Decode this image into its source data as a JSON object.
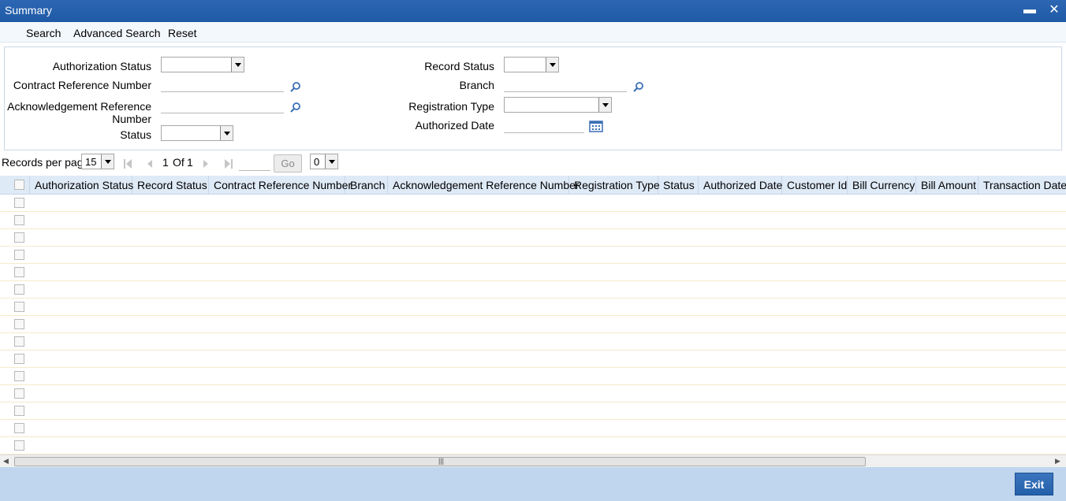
{
  "window": {
    "title": "Summary"
  },
  "toolbar": {
    "search": "Search",
    "advanced_search": "Advanced Search",
    "reset": "Reset"
  },
  "form": {
    "authorization_status": {
      "label": "Authorization Status",
      "value": ""
    },
    "contract_reference_number": {
      "label": "Contract Reference Number",
      "value": ""
    },
    "acknowledgement_reference_number": {
      "label_line1": "Acknowledgement Reference",
      "label_line2": "Number",
      "value": ""
    },
    "status": {
      "label": "Status",
      "value": ""
    },
    "record_status": {
      "label": "Record Status",
      "value": ""
    },
    "branch": {
      "label": "Branch",
      "value": ""
    },
    "registration_type": {
      "label": "Registration Type",
      "value": ""
    },
    "authorized_date": {
      "label": "Authorized Date",
      "value": ""
    }
  },
  "pager": {
    "records_per_page_label": "Records per page",
    "records_per_page": "15",
    "current_page": "1",
    "of_label": "Of",
    "total_pages": "1",
    "go_label": "Go",
    "jump_value": "0"
  },
  "grid": {
    "columns": [
      "Authorization Status",
      "Record Status",
      "Contract Reference Number",
      "Branch",
      "Acknowledgement Reference Number",
      "Registration Type",
      "Status",
      "Authorized Date",
      "Customer Id",
      "Bill Currency",
      "Bill Amount",
      "Transaction Date"
    ],
    "row_count": 15
  },
  "footer": {
    "exit_label": "Exit"
  },
  "colors": {
    "titlebar": "#1f5aa6",
    "footer": "#bfd6ee",
    "header": "#dfeaf7",
    "accent": "#2460aa"
  }
}
